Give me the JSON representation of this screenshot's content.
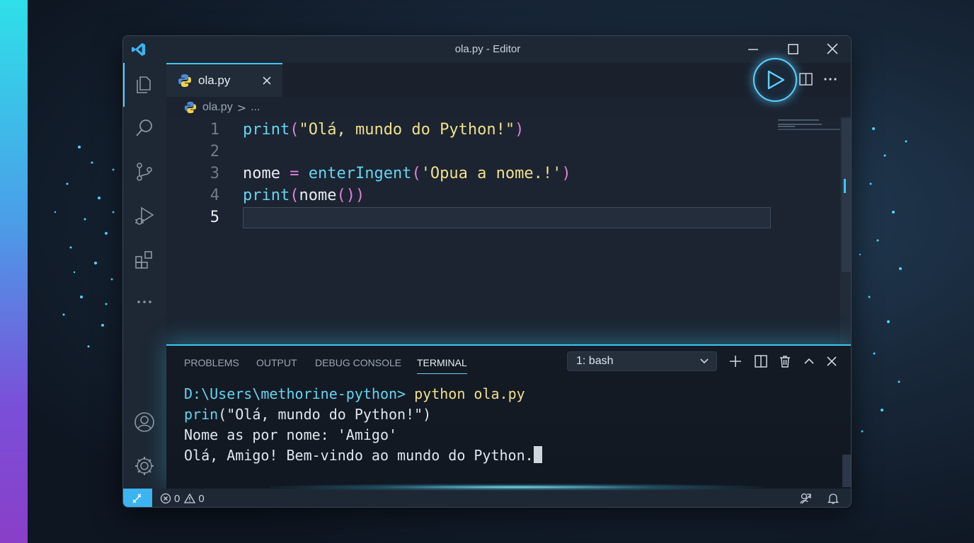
{
  "window": {
    "title": "ola.py - Editor"
  },
  "tab": {
    "label": "ola.py"
  },
  "breadcrumb": {
    "file": "ola.py",
    "separator": ">",
    "more": "..."
  },
  "editor": {
    "lines": [
      {
        "number": "1",
        "tokens": [
          {
            "t": "fn",
            "v": "print"
          },
          {
            "t": "paren",
            "v": "("
          },
          {
            "t": "str",
            "v": "\"Olá, mundo do Python!\""
          },
          {
            "t": "paren",
            "v": ")"
          }
        ]
      },
      {
        "number": "2",
        "tokens": []
      },
      {
        "number": "3",
        "tokens": [
          {
            "t": "var",
            "v": "nome "
          },
          {
            "t": "op",
            "v": "="
          },
          {
            "t": "var",
            "v": " "
          },
          {
            "t": "fn",
            "v": "enterIngent"
          },
          {
            "t": "paren",
            "v": "("
          },
          {
            "t": "str",
            "v": "'Opua a nome.!'"
          },
          {
            "t": "paren",
            "v": ")"
          }
        ]
      },
      {
        "number": "4",
        "tokens": [
          {
            "t": "fn",
            "v": "print"
          },
          {
            "t": "paren",
            "v": "("
          },
          {
            "t": "var",
            "v": "nome"
          },
          {
            "t": "paren",
            "v": "()"
          },
          {
            "t": "paren",
            "v": ")"
          }
        ]
      },
      {
        "number": "5",
        "tokens": []
      }
    ],
    "active_line": "5"
  },
  "panel": {
    "tabs": [
      "PROBLEMS",
      "OUTPUT",
      "DEBUG CONSOLE",
      "TERMINAL"
    ],
    "active_tab": "TERMINAL",
    "terminal_select": "1: bash"
  },
  "terminal": {
    "prompt": "D:\\Users\\methorine-python>",
    "command": " python ola.py",
    "line2_fn": "prin",
    "line2_rest": "(\"Olá, mundo do Python!\")",
    "line3": "Nome as por nome: 'Amigo'",
    "line4": "Olá, Amigo! Bem-vindo ao mundo do Python."
  },
  "statusbar": {
    "errors": "0",
    "warnings": "0"
  },
  "colors": {
    "accent": "#3cc8f0",
    "function": "#66d4f0",
    "string": "#f0e08a",
    "paren": "#e080d8"
  }
}
